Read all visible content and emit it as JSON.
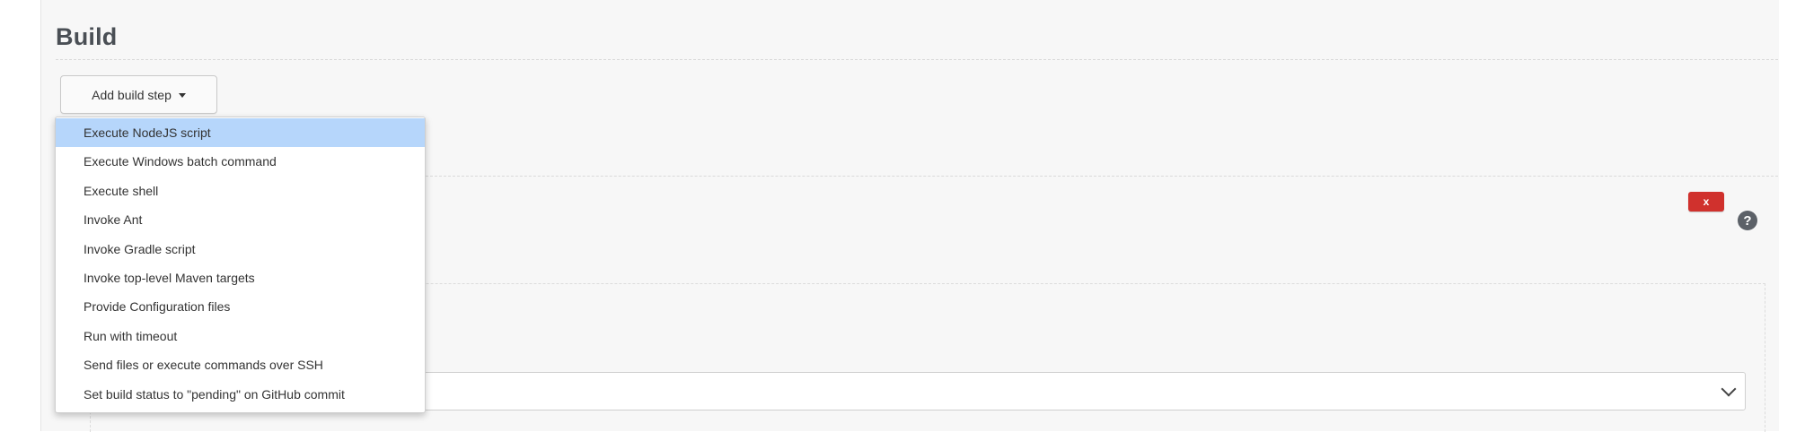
{
  "section": {
    "title": "Build"
  },
  "add_build_step": {
    "label": "Add build step"
  },
  "menu": {
    "items": [
      {
        "label": "Execute NodeJS script",
        "active": true
      },
      {
        "label": "Execute Windows batch command"
      },
      {
        "label": "Execute shell"
      },
      {
        "label": "Invoke Ant"
      },
      {
        "label": "Invoke Gradle script"
      },
      {
        "label": "Invoke top-level Maven targets"
      },
      {
        "label": "Provide Configuration files"
      },
      {
        "label": "Run with timeout"
      },
      {
        "label": "Send files or execute commands over SSH"
      },
      {
        "label": "Set build status to \"pending\" on GitHub commit"
      }
    ]
  },
  "step_panel": {
    "delete_label": "x",
    "help_label": "?"
  },
  "colors": {
    "highlight": "#b6d6fb",
    "delete": "#d0312d",
    "background": "#f7f7f7"
  }
}
